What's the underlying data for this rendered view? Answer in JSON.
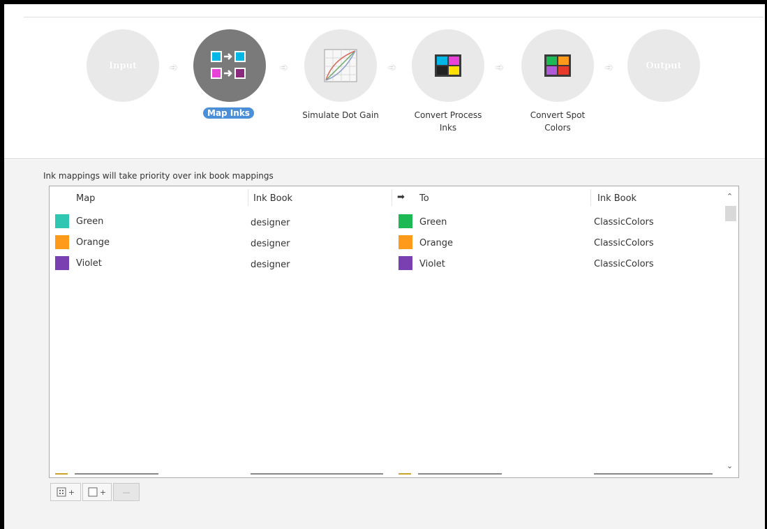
{
  "workflow": {
    "steps": [
      {
        "label": "Input",
        "icon": "input-icon"
      },
      {
        "label": "Map Inks",
        "icon": "map-inks-icon"
      },
      {
        "label": "Simulate Dot Gain",
        "icon": "dot-gain-curve-icon"
      },
      {
        "label": "Convert Process Inks",
        "line1": "Convert Process",
        "line2": "Inks",
        "icon": "cmyk-process-icon"
      },
      {
        "label": "Convert Spot Colors",
        "line1": "Convert Spot",
        "line2": "Colors",
        "icon": "spot-colors-icon"
      },
      {
        "label": "Output",
        "icon": "output-icon"
      }
    ],
    "active_step": "Map Inks"
  },
  "note": "Ink mappings will take priority over ink book mappings",
  "table": {
    "columns": {
      "map": "Map",
      "ink_book": "Ink Book",
      "to": "To",
      "to_ink_book": "Ink Book"
    },
    "arrow_icon": "arrow-right-icon",
    "rows": [
      {
        "map": "Green",
        "map_color": "#2fc7b1",
        "ink_book": "designer",
        "to": "Green",
        "to_color": "#1db954",
        "to_ink_book": "ClassicColors"
      },
      {
        "map": "Orange",
        "map_color": "#ff9a1a",
        "ink_book": "designer",
        "to": "Orange",
        "to_color": "#ff9a1a",
        "to_ink_book": "ClassicColors"
      },
      {
        "map": "Violet",
        "map_color": "#7a3fb0",
        "ink_book": "designer",
        "to": "Violet",
        "to_color": "#7a3fb0",
        "to_ink_book": "ClassicColors"
      }
    ]
  },
  "toolbar": {
    "add_group_icon": "add-ink-group-icon",
    "add_item_icon": "add-ink-icon",
    "remove_icon": "remove-icon",
    "plus": "+",
    "minus": "—"
  }
}
